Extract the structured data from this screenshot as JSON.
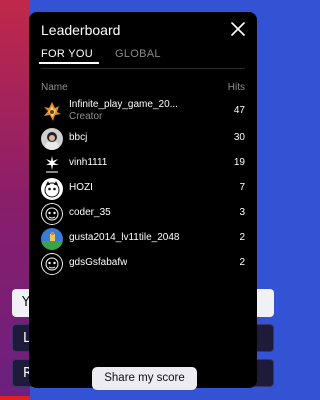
{
  "background": {
    "buttons": [
      "Y",
      "L",
      "R"
    ]
  },
  "leaderboard": {
    "title": "Leaderboard",
    "tabs": [
      {
        "label": "FOR YOU",
        "active": true
      },
      {
        "label": "GLOBAL",
        "active": false
      }
    ],
    "columns": {
      "name": "Name",
      "hits": "Hits"
    },
    "rows": [
      {
        "name": "Infinite_play_game_20...",
        "subtitle": "Creator",
        "hits": "47",
        "avatar": "fire-sprite-icon"
      },
      {
        "name": "bbcj",
        "hits": "30",
        "avatar": "person-photo-icon"
      },
      {
        "name": "vinh1111",
        "hits": "19",
        "avatar": "sparkle-icon"
      },
      {
        "name": "HOZI",
        "hits": "7",
        "avatar": "cute-character-icon"
      },
      {
        "name": "coder_35",
        "hits": "3",
        "avatar": "default-avatar-icon"
      },
      {
        "name": "gusta2014_lv11tile_2048",
        "hits": "2",
        "avatar": "game-scene-icon"
      },
      {
        "name": "gdsGsfabafw",
        "hits": "2",
        "avatar": "default-avatar-icon"
      }
    ],
    "share_label": "Share my score"
  },
  "colors": {
    "modal_bg": "#000000",
    "page_bg": "#3452d4",
    "share_bg": "#ececf2",
    "muted_text": "#8f8f8f"
  }
}
